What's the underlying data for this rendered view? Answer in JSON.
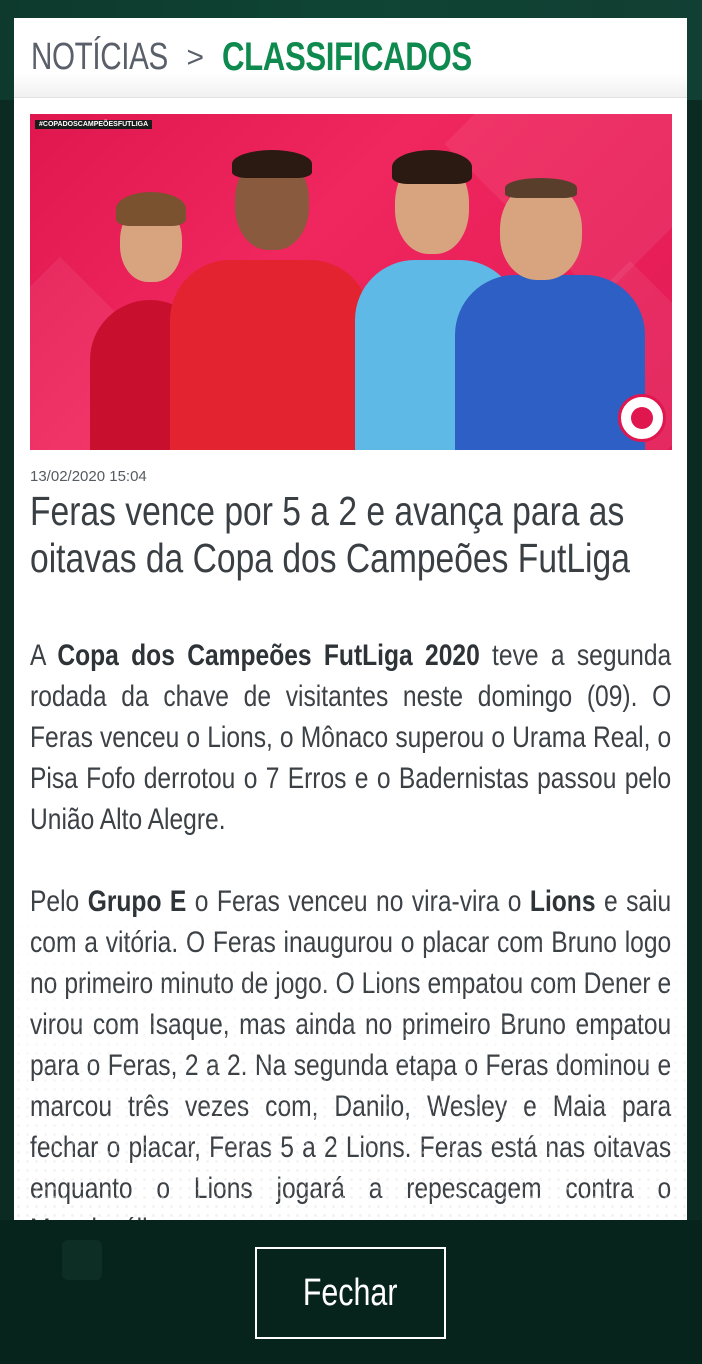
{
  "header": {
    "breadcrumb_parent": "NOTÍCIAS",
    "separator": ">",
    "breadcrumb_current": "CLASSIFICADOS"
  },
  "hero": {
    "tag": "#COPADOSCAMPEÕESFUTLIGA",
    "badge_icon": "trophy-badge-icon"
  },
  "article": {
    "date": "13/02/2020 15:04",
    "title": "Feras vence por 5 a 2 e avança para as oitavas da Copa dos Campeões FutLiga",
    "p1_a": "A ",
    "p1_b": "Copa dos Campeões FutLiga 2020",
    "p1_c": " teve a segunda rodada da chave de visitantes neste domingo (09). O Feras venceu o Lions, o Mônaco superou o Urama Real, o Pisa Fofo derrotou o 7 Erros e o Badernistas passou pelo União Alto Alegre.",
    "p2_a": "Pelo ",
    "p2_b": "Grupo E",
    "p2_c": " o Feras venceu no vira-vira o ",
    "p2_d": "Lions",
    "p2_e": " e saiu com a vitória. O Feras inaugurou o placar com Bruno logo no primeiro minuto de jogo. O Lions empatou com Dener e virou com Isaque, mas ainda no primeiro Bruno empatou para o Feras, 2 a 2. Na segunda etapa o Feras dominou e marcou três vezes com, Danilo, Wesley e Maia para fechar o placar, Feras 5 a 2 Lions. Feras está nas oitavas enquanto o Lions jogará a repescagem contra o Maquiavélicos."
  },
  "footer": {
    "close_label": "Fechar"
  },
  "colors": {
    "accent_green": "#0f8a4f",
    "hero_pink": "#e0164f",
    "backdrop": "#0b2a22"
  }
}
